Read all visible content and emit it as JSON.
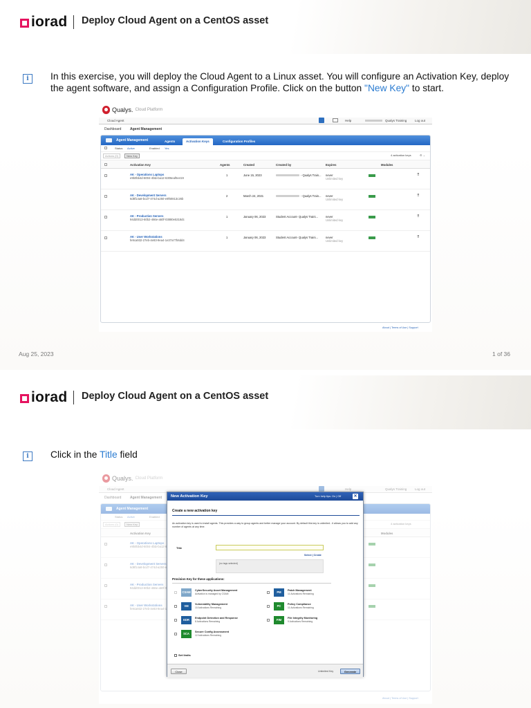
{
  "brand": {
    "logo_text": "iorad",
    "accent": "#e5135f"
  },
  "doc_title": "Deploy Cloud Agent on a CentOS asset",
  "page1": {
    "instruction_pre": "In this exercise, you will deploy the Cloud Agent to a Linux asset.   You will configure an Activation Key, deploy the agent software, and assign a Configuration Profile.   Click on the button ",
    "instruction_highlight": "\"New Key\"",
    "instruction_post": " to start.",
    "footer_date": "Aug 25, 2023",
    "footer_page": "1 of 36"
  },
  "page2": {
    "instruction_pre": "Click in the ",
    "instruction_highlight": "Title",
    "instruction_post": " field"
  },
  "qualys": {
    "logo": "Qualys.",
    "logo_sub": "Cloud Platform",
    "module": "Cloud Agent",
    "help": "Help",
    "user": "Qualys Training",
    "logout": "Log out",
    "sub_dashboard": "Dashboard",
    "sub_current": "Agent Management",
    "panel_title": "Agent Management",
    "tabs": [
      "Agents",
      "Activation Keys",
      "Configuration Profiles"
    ],
    "filter_status": "Status",
    "filter_active": "Active",
    "filter_enabled": "Enabled",
    "filter_yes": "Yes",
    "btn_actions": "Actions (0)",
    "btn_newkey": "New Key",
    "count": "4 activation keys",
    "columns": [
      "Activation Key",
      "Agents",
      "Created",
      "Created by",
      "Expires",
      "Modules"
    ],
    "rows": [
      {
        "name": "AK - Operations Laptops",
        "id": "e9b0bb4d-6004-4fab-ba12-6306eaf6e419",
        "agents": "1",
        "created": "June 15, 2023",
        "by": "- Qualys Train...",
        "expires": "never",
        "expires_sub": "Unlimited key"
      },
      {
        "name": "AK - Development Servers",
        "id": "6d8f14a8-bcd7-474d-a250-e9f60813c26b",
        "agents": "2",
        "created": "March 24, 2021",
        "by": "- Qualys Train...",
        "expires": "never",
        "expires_sub": "Unlimited key"
      },
      {
        "name": "AK - Production Servers",
        "id": "94dd0013-60b2-466e-a50f-03880e5318dc",
        "agents": "1",
        "created": "January 06, 2023",
        "by": "Student Account- Qualys Traini...",
        "expires": "never",
        "expires_sub": "Unlimited key"
      },
      {
        "name": "AK - User Workstations",
        "id": "fe9ca932-27eb-4e83-9ea4-1e37a77b6dd4",
        "agents": "1",
        "created": "January 06, 2023",
        "by": "Student Account- Qualys Traini...",
        "expires": "never",
        "expires_sub": "Unlimited key"
      }
    ],
    "footer_links": "About | Terms of Use | Support"
  },
  "modal": {
    "title": "New Activation Key",
    "tips": "Turn help tips: On | Off",
    "heading": "Create a new activation key",
    "desc": "An activation key is used to install agents. This provides a way to group agents and better manage your account. By default this key is unlimited - it allows you to add any number of agents at any time.",
    "title_label": "Title",
    "links": "Select | Create",
    "tag_placeholder": "(no tags selected)",
    "provision_heading": "Provision Key for these applications:",
    "apps_left": [
      {
        "code": "CSAM",
        "name": "CyberSecurity Asset Management",
        "sub": "Activation is managed by CSAM",
        "color": "#7fa7c9"
      },
      {
        "code": "VM",
        "name": "Vulnerability Management",
        "sub": "10 Activations Remaining",
        "color": "#1f5e9e"
      },
      {
        "code": "EDR",
        "name": "Endpoint Detection and Response",
        "sub": "8 Activations Remaining",
        "color": "#1f5e9e"
      },
      {
        "code": "SCA",
        "name": "Secure Config Assessment",
        "sub": "12 Activations Remaining",
        "color": "#1f8a2e"
      }
    ],
    "apps_right": [
      {
        "code": "PM",
        "name": "Patch Management",
        "sub": "11 Activations Remaining",
        "color": "#1f5e9e"
      },
      {
        "code": "PC",
        "name": "Policy Compliance",
        "sub": "11 Activations Remaining",
        "color": "#1f8a2e"
      },
      {
        "code": "FIM",
        "name": "File Integrity Monitoring",
        "sub": "9 Activations Remaining",
        "color": "#1f8a2e"
      }
    ],
    "set_limits": "Set limits",
    "close": "Close",
    "unlimited": "Unlimited Key",
    "generate": "Generate"
  }
}
